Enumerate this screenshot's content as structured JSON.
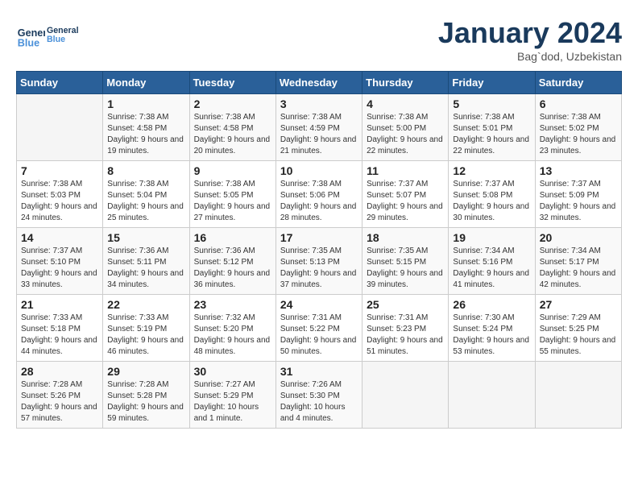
{
  "header": {
    "logo_line1": "General",
    "logo_line2": "Blue",
    "month": "January 2024",
    "location": "Bag`dod, Uzbekistan"
  },
  "weekdays": [
    "Sunday",
    "Monday",
    "Tuesday",
    "Wednesday",
    "Thursday",
    "Friday",
    "Saturday"
  ],
  "weeks": [
    [
      {
        "day": "",
        "sunrise": "",
        "sunset": "",
        "daylight": ""
      },
      {
        "day": "1",
        "sunrise": "Sunrise: 7:38 AM",
        "sunset": "Sunset: 4:58 PM",
        "daylight": "Daylight: 9 hours and 19 minutes."
      },
      {
        "day": "2",
        "sunrise": "Sunrise: 7:38 AM",
        "sunset": "Sunset: 4:58 PM",
        "daylight": "Daylight: 9 hours and 20 minutes."
      },
      {
        "day": "3",
        "sunrise": "Sunrise: 7:38 AM",
        "sunset": "Sunset: 4:59 PM",
        "daylight": "Daylight: 9 hours and 21 minutes."
      },
      {
        "day": "4",
        "sunrise": "Sunrise: 7:38 AM",
        "sunset": "Sunset: 5:00 PM",
        "daylight": "Daylight: 9 hours and 22 minutes."
      },
      {
        "day": "5",
        "sunrise": "Sunrise: 7:38 AM",
        "sunset": "Sunset: 5:01 PM",
        "daylight": "Daylight: 9 hours and 22 minutes."
      },
      {
        "day": "6",
        "sunrise": "Sunrise: 7:38 AM",
        "sunset": "Sunset: 5:02 PM",
        "daylight": "Daylight: 9 hours and 23 minutes."
      }
    ],
    [
      {
        "day": "7",
        "sunrise": "Sunrise: 7:38 AM",
        "sunset": "Sunset: 5:03 PM",
        "daylight": "Daylight: 9 hours and 24 minutes."
      },
      {
        "day": "8",
        "sunrise": "Sunrise: 7:38 AM",
        "sunset": "Sunset: 5:04 PM",
        "daylight": "Daylight: 9 hours and 25 minutes."
      },
      {
        "day": "9",
        "sunrise": "Sunrise: 7:38 AM",
        "sunset": "Sunset: 5:05 PM",
        "daylight": "Daylight: 9 hours and 27 minutes."
      },
      {
        "day": "10",
        "sunrise": "Sunrise: 7:38 AM",
        "sunset": "Sunset: 5:06 PM",
        "daylight": "Daylight: 9 hours and 28 minutes."
      },
      {
        "day": "11",
        "sunrise": "Sunrise: 7:37 AM",
        "sunset": "Sunset: 5:07 PM",
        "daylight": "Daylight: 9 hours and 29 minutes."
      },
      {
        "day": "12",
        "sunrise": "Sunrise: 7:37 AM",
        "sunset": "Sunset: 5:08 PM",
        "daylight": "Daylight: 9 hours and 30 minutes."
      },
      {
        "day": "13",
        "sunrise": "Sunrise: 7:37 AM",
        "sunset": "Sunset: 5:09 PM",
        "daylight": "Daylight: 9 hours and 32 minutes."
      }
    ],
    [
      {
        "day": "14",
        "sunrise": "Sunrise: 7:37 AM",
        "sunset": "Sunset: 5:10 PM",
        "daylight": "Daylight: 9 hours and 33 minutes."
      },
      {
        "day": "15",
        "sunrise": "Sunrise: 7:36 AM",
        "sunset": "Sunset: 5:11 PM",
        "daylight": "Daylight: 9 hours and 34 minutes."
      },
      {
        "day": "16",
        "sunrise": "Sunrise: 7:36 AM",
        "sunset": "Sunset: 5:12 PM",
        "daylight": "Daylight: 9 hours and 36 minutes."
      },
      {
        "day": "17",
        "sunrise": "Sunrise: 7:35 AM",
        "sunset": "Sunset: 5:13 PM",
        "daylight": "Daylight: 9 hours and 37 minutes."
      },
      {
        "day": "18",
        "sunrise": "Sunrise: 7:35 AM",
        "sunset": "Sunset: 5:15 PM",
        "daylight": "Daylight: 9 hours and 39 minutes."
      },
      {
        "day": "19",
        "sunrise": "Sunrise: 7:34 AM",
        "sunset": "Sunset: 5:16 PM",
        "daylight": "Daylight: 9 hours and 41 minutes."
      },
      {
        "day": "20",
        "sunrise": "Sunrise: 7:34 AM",
        "sunset": "Sunset: 5:17 PM",
        "daylight": "Daylight: 9 hours and 42 minutes."
      }
    ],
    [
      {
        "day": "21",
        "sunrise": "Sunrise: 7:33 AM",
        "sunset": "Sunset: 5:18 PM",
        "daylight": "Daylight: 9 hours and 44 minutes."
      },
      {
        "day": "22",
        "sunrise": "Sunrise: 7:33 AM",
        "sunset": "Sunset: 5:19 PM",
        "daylight": "Daylight: 9 hours and 46 minutes."
      },
      {
        "day": "23",
        "sunrise": "Sunrise: 7:32 AM",
        "sunset": "Sunset: 5:20 PM",
        "daylight": "Daylight: 9 hours and 48 minutes."
      },
      {
        "day": "24",
        "sunrise": "Sunrise: 7:31 AM",
        "sunset": "Sunset: 5:22 PM",
        "daylight": "Daylight: 9 hours and 50 minutes."
      },
      {
        "day": "25",
        "sunrise": "Sunrise: 7:31 AM",
        "sunset": "Sunset: 5:23 PM",
        "daylight": "Daylight: 9 hours and 51 minutes."
      },
      {
        "day": "26",
        "sunrise": "Sunrise: 7:30 AM",
        "sunset": "Sunset: 5:24 PM",
        "daylight": "Daylight: 9 hours and 53 minutes."
      },
      {
        "day": "27",
        "sunrise": "Sunrise: 7:29 AM",
        "sunset": "Sunset: 5:25 PM",
        "daylight": "Daylight: 9 hours and 55 minutes."
      }
    ],
    [
      {
        "day": "28",
        "sunrise": "Sunrise: 7:28 AM",
        "sunset": "Sunset: 5:26 PM",
        "daylight": "Daylight: 9 hours and 57 minutes."
      },
      {
        "day": "29",
        "sunrise": "Sunrise: 7:28 AM",
        "sunset": "Sunset: 5:28 PM",
        "daylight": "Daylight: 9 hours and 59 minutes."
      },
      {
        "day": "30",
        "sunrise": "Sunrise: 7:27 AM",
        "sunset": "Sunset: 5:29 PM",
        "daylight": "Daylight: 10 hours and 1 minute."
      },
      {
        "day": "31",
        "sunrise": "Sunrise: 7:26 AM",
        "sunset": "Sunset: 5:30 PM",
        "daylight": "Daylight: 10 hours and 4 minutes."
      },
      {
        "day": "",
        "sunrise": "",
        "sunset": "",
        "daylight": ""
      },
      {
        "day": "",
        "sunrise": "",
        "sunset": "",
        "daylight": ""
      },
      {
        "day": "",
        "sunrise": "",
        "sunset": "",
        "daylight": ""
      }
    ]
  ]
}
